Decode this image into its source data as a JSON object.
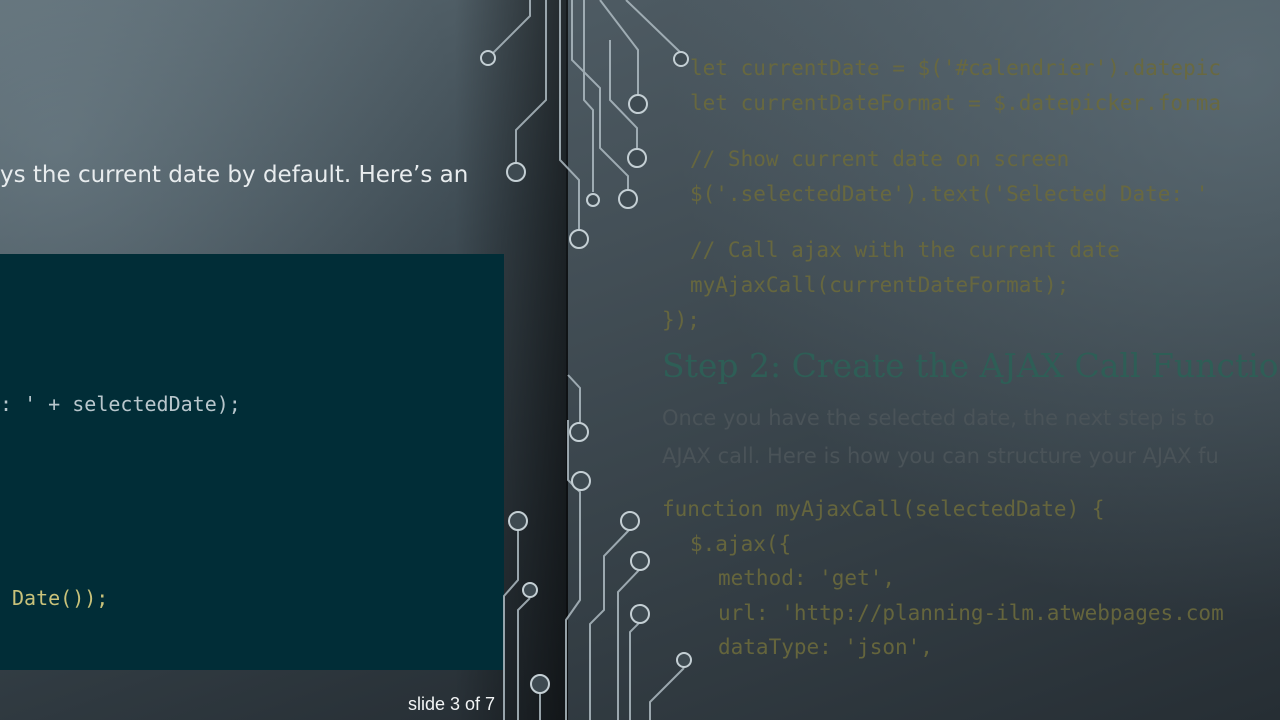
{
  "slide_left": {
    "intro_text": "ys the current date by default. Here’s an",
    "code_lines": [
      ": ' + selectedDate);",
      "Date());"
    ]
  },
  "slide_right": {
    "code_top": [
      "let currentDate = $('#calendrier').datepic",
      "let currentDateFormat = $.datepicker.forma",
      "// Show current date on screen",
      "$('.selectedDate').text('Selected Date: '",
      "// Call ajax with the current date",
      "myAjaxCall(currentDateFormat);",
      "});"
    ],
    "heading": "Step 2: Create the AJAX Call Functio",
    "paragraph": [
      "Once you have the selected date, the next step is to",
      "AJAX call. Here is how you can structure your AJAX fu"
    ],
    "code_bottom": [
      "function myAjaxCall(selectedDate) {",
      "$.ajax({",
      "method: 'get',",
      "url: 'http://planning-ilm.atwebpages.com",
      "dataType: 'json',"
    ]
  },
  "footer": {
    "slide_counter": "slide 3 of 7"
  },
  "colors": {
    "code_panel_bg": "#012d37",
    "faded_code": "#6b6a3c",
    "heading": "#2e5e56",
    "circuit": "#aebbc2"
  }
}
